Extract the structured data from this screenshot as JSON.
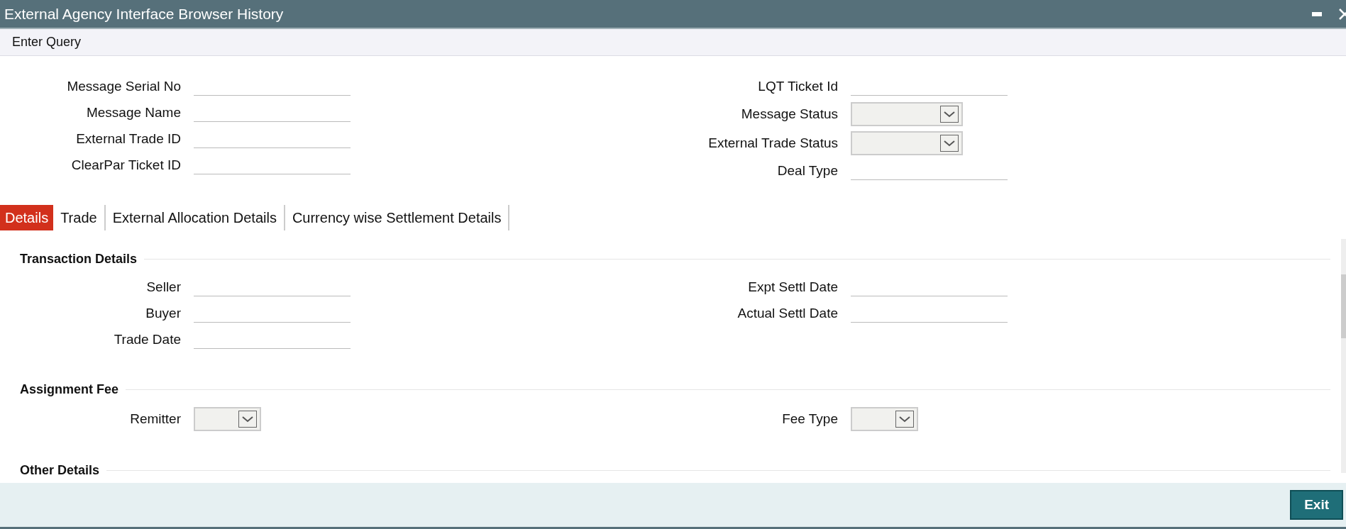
{
  "window": {
    "title": "External Agency Interface Browser History"
  },
  "toolbar": {
    "label": "Enter Query"
  },
  "query": {
    "left": [
      {
        "label": "Message Serial No",
        "kind": "text"
      },
      {
        "label": "Message Name",
        "kind": "text"
      },
      {
        "label": "External Trade ID",
        "kind": "text"
      },
      {
        "label": "ClearPar Ticket ID",
        "kind": "text"
      }
    ],
    "right": [
      {
        "label": "LQT Ticket Id",
        "kind": "text"
      },
      {
        "label": "Message Status",
        "kind": "select"
      },
      {
        "label": "External Trade Status",
        "kind": "select"
      },
      {
        "label": "Deal Type",
        "kind": "text"
      }
    ]
  },
  "tabs": [
    {
      "label": "Details",
      "selected": true
    },
    {
      "label": "Trade",
      "selected": false
    },
    {
      "label": "External Allocation Details",
      "selected": false
    },
    {
      "label": "Currency wise Settlement Details",
      "selected": false
    }
  ],
  "sections": [
    {
      "title": "Transaction Details",
      "left": [
        {
          "label": "Seller",
          "kind": "text"
        },
        {
          "label": "Buyer",
          "kind": "text"
        },
        {
          "label": "Trade Date",
          "kind": "text"
        }
      ],
      "right": [
        {
          "label": "Expt Settl Date",
          "kind": "text"
        },
        {
          "label": "Actual Settl Date",
          "kind": "text"
        }
      ]
    },
    {
      "title": "Assignment Fee",
      "left": [
        {
          "label": "Remitter",
          "kind": "select"
        }
      ],
      "right": [
        {
          "label": "Fee Type",
          "kind": "select"
        }
      ]
    },
    {
      "title": "Other Details"
    }
  ],
  "footer": {
    "buttons": [
      "Exit"
    ]
  }
}
